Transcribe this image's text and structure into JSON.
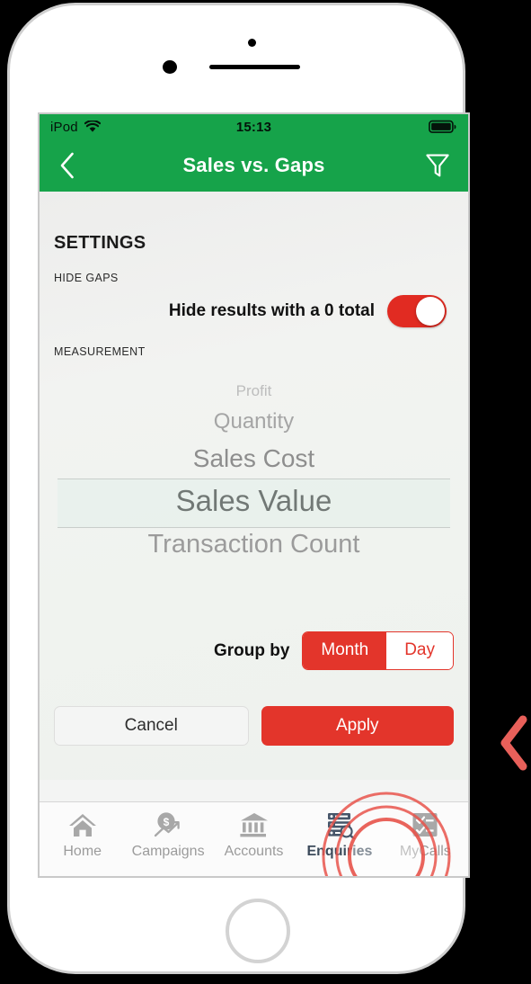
{
  "device": {
    "frame": "iphone-white",
    "sensor_icons": [
      "proximity-sensor",
      "front-camera",
      "earpiece-speaker",
      "home-button"
    ]
  },
  "status_bar": {
    "carrier": "iPod",
    "wifi_icon": "wifi-icon",
    "time": "15:13",
    "battery_icon": "battery-full-icon",
    "background_color": "#16a34a"
  },
  "nav_bar": {
    "back_icon": "chevron-left-icon",
    "title": "Sales vs. Gaps",
    "filter_icon": "funnel-filter-icon",
    "background_color": "#16a34a",
    "title_color": "#ffffff"
  },
  "settings": {
    "heading": "SETTINGS",
    "hide_gaps": {
      "group_label": "HIDE GAPS",
      "row_label": "Hide results with a 0 total",
      "toggle_state": "on",
      "toggle_on_color": "#e12b22"
    },
    "measurement": {
      "group_label": "MEASUREMENT",
      "options": [
        "Profit",
        "Quantity",
        "Sales Cost",
        "Sales Value",
        "Transaction Count"
      ],
      "selected": "Sales Value",
      "selected_index": 3
    },
    "group_by": {
      "label": "Group by",
      "options": [
        "Month",
        "Day"
      ],
      "selected": "Month",
      "accent_color": "#e3352b"
    },
    "actions": {
      "cancel_label": "Cancel",
      "apply_label": "Apply",
      "apply_color": "#e3352b"
    }
  },
  "tap_indicator": {
    "target": "Apply",
    "icon": "tap-ripple-icon",
    "color": "#e8544b"
  },
  "annotation": {
    "icon": "chevron-left-icon",
    "color": "#e8605a"
  },
  "tab_bar": {
    "items": [
      {
        "label": "Home",
        "icon": "home-icon",
        "active": false
      },
      {
        "label": "Campaigns",
        "icon": "campaigns-dollar-trend-icon",
        "active": false
      },
      {
        "label": "Accounts",
        "icon": "bank-columns-icon",
        "active": false
      },
      {
        "label": "Enquiries",
        "icon": "server-search-icon",
        "active": true
      },
      {
        "label": "MyCalls",
        "icon": "checklist-icon",
        "active": false
      }
    ],
    "active_index": 3,
    "active_color": "#3b4a5a",
    "inactive_color": "#9b9b9b"
  }
}
